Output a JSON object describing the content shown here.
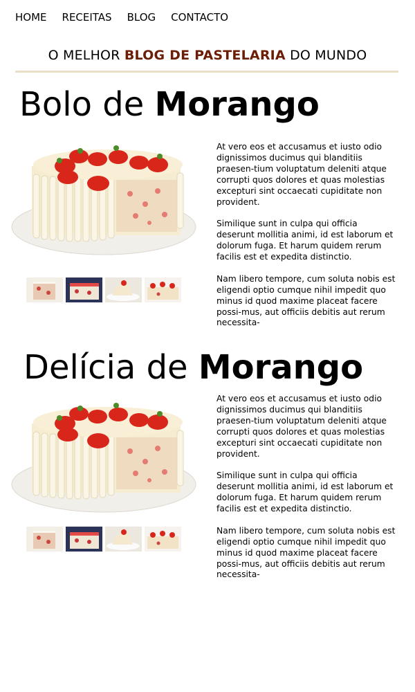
{
  "nav": {
    "items": [
      "HOME",
      "RECEITAS",
      "BLOG",
      "CONTACTO"
    ]
  },
  "header": {
    "tagline_before": "O MELHOR ",
    "tagline_highlight": "BLOG DE PASTELARIA",
    "tagline_after": " DO MUNDO",
    "highlight_color": "#6b1d06",
    "rule_color": "#e8dfc4"
  },
  "posts": [
    {
      "title_normal": "Bolo de ",
      "title_bold": "Morango",
      "paragraphs": [
        "At vero eos et accusamus et iusto odio dignissimos ducimus qui blanditiis praesen-tium voluptatum deleniti atque corrupti quos dolores et quas molestias excepturi sint occaecati cupiditate non provident.",
        "Similique sunt in culpa qui officia deserunt mollitia animi, id est laborum et dolorum fuga. Et harum quidem rerum facilis est et expedita distinctio.",
        "Nam libero tempore, cum soluta nobis est eligendi optio cumque nihil impedit quo minus id quod maxime placeat facere possi-mus, aut officiis debitis aut rerum necessita-"
      ]
    },
    {
      "title_normal": "Delícia de ",
      "title_bold": "Morango",
      "paragraphs": [
        "At vero eos et accusamus et iusto odio dignissimos ducimus qui blanditiis praesen-tium voluptatum deleniti atque corrupti quos dolores et quas molestias excepturi sint occaecati cupiditate non provident.",
        "Similique sunt in culpa qui officia deserunt mollitia animi, id est laborum et dolorum fuga. Et harum quidem rerum facilis est et expedita distinctio.",
        "Nam libero tempore, cum soluta nobis est eligendi optio cumque nihil impedit quo minus id quod maxime placeat facere possi-mus, aut officiis debitis aut rerum necessita-"
      ]
    }
  ]
}
